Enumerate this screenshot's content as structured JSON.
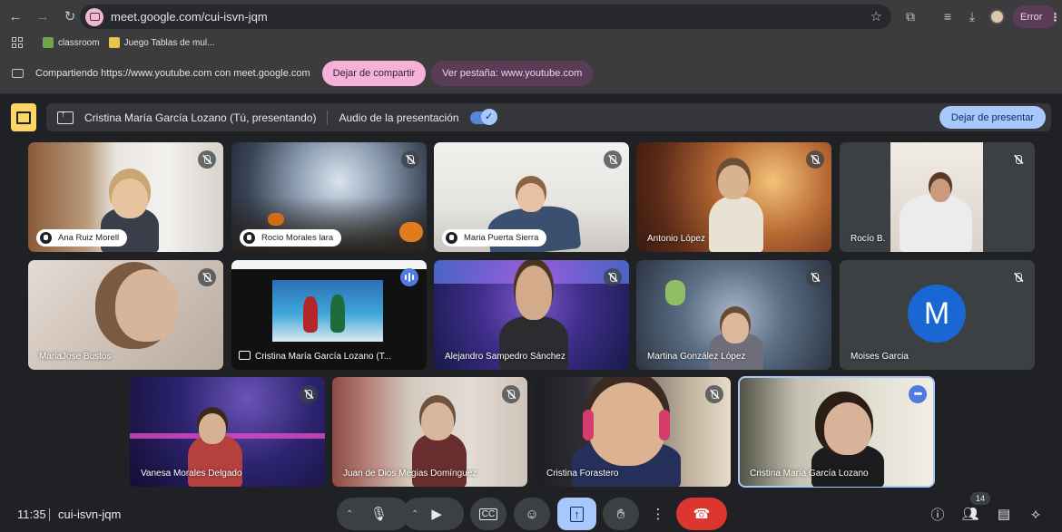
{
  "browser": {
    "url": "meet.google.com/cui-isvn-jqm",
    "error_label": "Error",
    "bookmarks": [
      {
        "label": "classroom"
      },
      {
        "label": "Juego Tablas de mul..."
      }
    ]
  },
  "sharing_bar": {
    "text": "Compartiendo https://www.youtube.com con meet.google.com",
    "stop_share_label": "Dejar de compartir",
    "view_tab_label": "Ver pestaña: www.youtube.com"
  },
  "presenting_bar": {
    "presenter": "Cristina María García Lozano (Tú, presentando)",
    "audio_label": "Audio de la presentación",
    "audio_enabled": true,
    "stop_present_label": "Dejar de presentar"
  },
  "participants": [
    {
      "name": "Ana Ruiz Morell",
      "muted": true,
      "hand_raised": true
    },
    {
      "name": "Rocio Morales lara",
      "muted": true,
      "hand_raised": true
    },
    {
      "name": "Maria Puerta Sierra",
      "muted": true,
      "hand_raised": true
    },
    {
      "name": "Antonio López",
      "muted": true
    },
    {
      "name": "Rocío B.",
      "muted": true
    },
    {
      "name": "MariaJose Bustos",
      "muted": true
    },
    {
      "name": "Cristina María García Lozano (T...",
      "presenting": true,
      "speaking": true
    },
    {
      "name": "Alejandro Sampedro Sánchez",
      "muted": true
    },
    {
      "name": "Martina González López",
      "muted": true
    },
    {
      "name": "Moises Garcia",
      "muted": true,
      "initial": "M"
    },
    {
      "name": "Vanesa Morales Delgado",
      "muted": true
    },
    {
      "name": "Juan de Dios Megias Domínguez",
      "muted": true
    },
    {
      "name": "Cristina Forastero",
      "muted": true
    },
    {
      "name": "Cristina María García Lozano",
      "self": true
    }
  ],
  "bottom_bar": {
    "time": "11:35",
    "meeting_code": "cui-isvn-jqm",
    "participant_count": "14"
  },
  "colors": {
    "background": "#202124",
    "accent": "#a8c7fa",
    "end_call": "#dc362e",
    "avatar_blue": "#1967d2",
    "present_badge": "#fcd663"
  }
}
